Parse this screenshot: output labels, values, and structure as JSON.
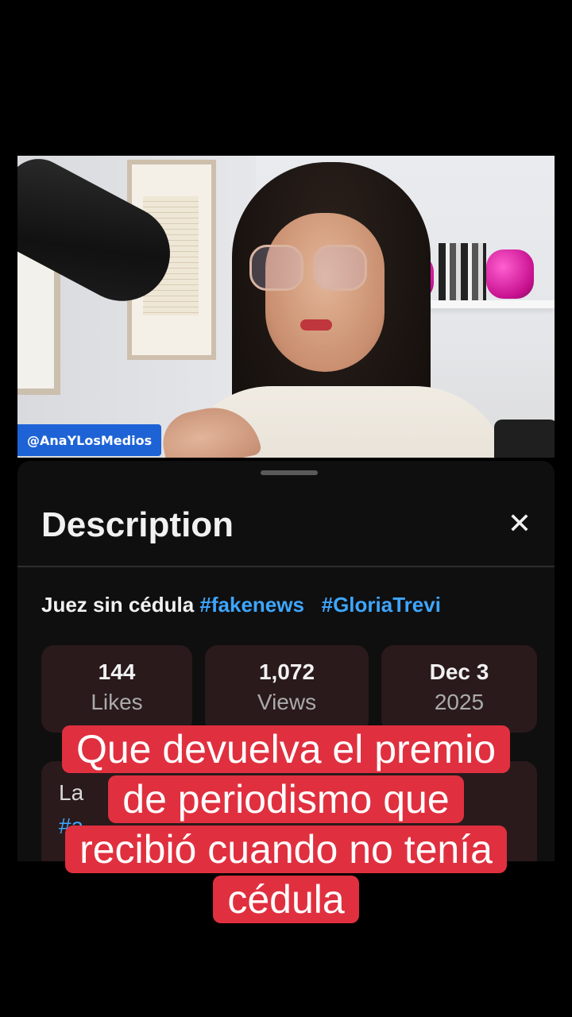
{
  "video": {
    "channel_handle": "@AnaYLosMedios"
  },
  "description_sheet": {
    "title": "Description",
    "close_icon": "close-icon",
    "video_title_text": "Juez sin cédula",
    "hashtags": [
      "#fakenews",
      "#GloriaTrevi"
    ],
    "stats": [
      {
        "value": "144",
        "label": "Likes"
      },
      {
        "value": "1,072",
        "label": "Views"
      },
      {
        "value": "Dec 3",
        "label": "2025"
      }
    ],
    "more_text": "La",
    "more_link": "#a"
  },
  "caption": {
    "lines": [
      "Que devuelva el premio",
      "de periodismo que",
      "recibió cuando no tenía",
      "cédula"
    ],
    "background_color": "#e0303f"
  }
}
